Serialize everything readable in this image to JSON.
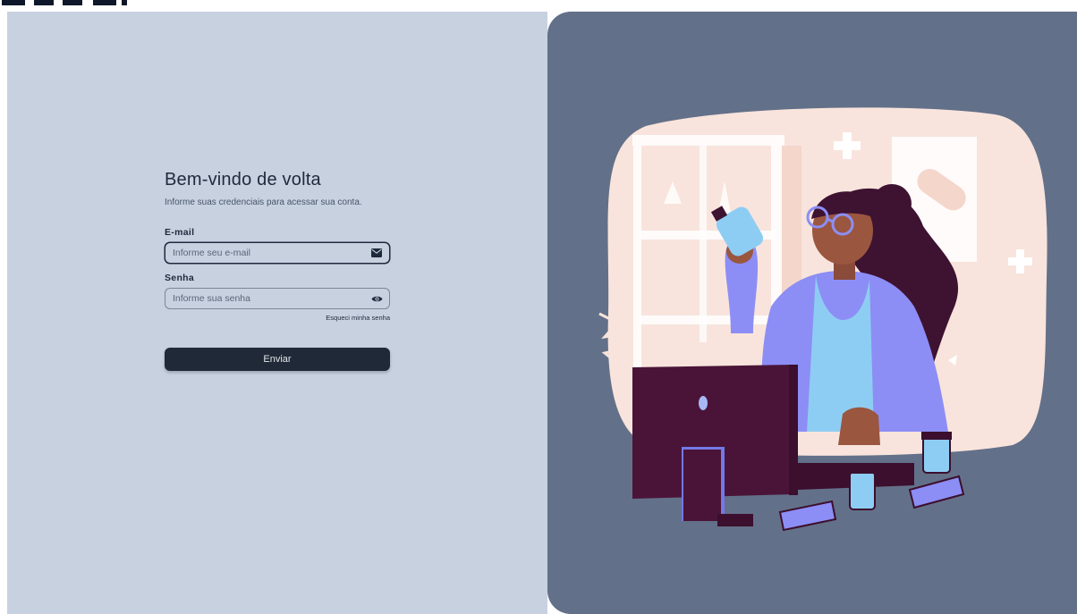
{
  "login": {
    "title": "Bem-vindo de volta",
    "subtitle": "Informe suas credenciais para acessar sua conta.",
    "email_label": "E-mail",
    "email_placeholder": "Informe seu e-mail",
    "password_label": "Senha",
    "password_placeholder": "Informe sua senha",
    "forgot_password": "Esqueci minha senha",
    "submit_label": "Enviar"
  },
  "icons": {
    "email": "envelope-icon",
    "password": "eye-icon"
  },
  "colors": {
    "left_background": "#c8d1e0",
    "right_background": "#637089",
    "primary_button": "#1f2937",
    "text": "#1e293b"
  }
}
